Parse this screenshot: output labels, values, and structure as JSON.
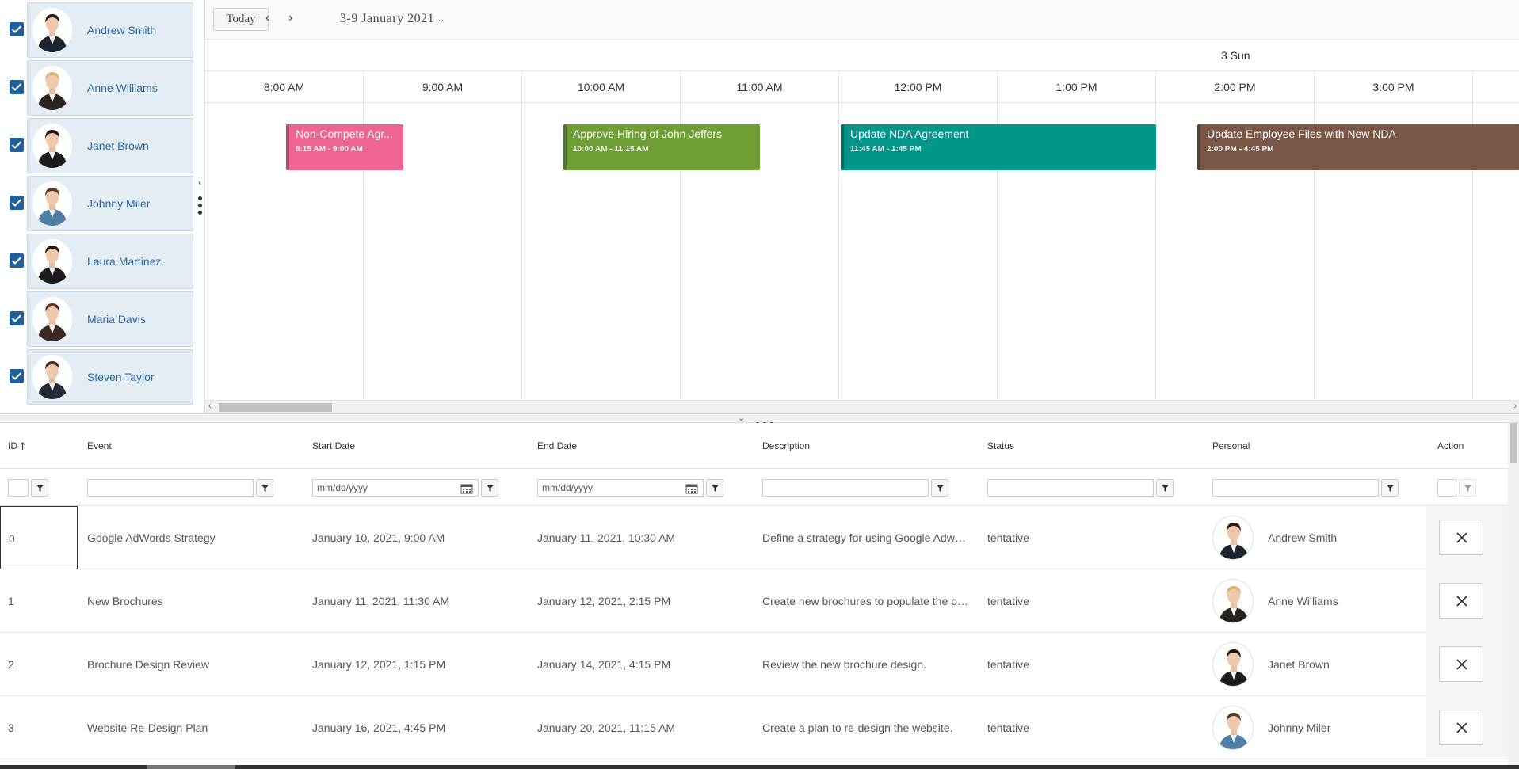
{
  "people": [
    {
      "name": "Andrew Smith",
      "checked": true,
      "suit": "#1c2430",
      "hair": "#2b1d14"
    },
    {
      "name": "Anne Williams",
      "checked": true,
      "suit": "#2a2420",
      "hair": "#d9b77a"
    },
    {
      "name": "Janet Brown",
      "checked": true,
      "suit": "#1d1d1d",
      "hair": "#201611"
    },
    {
      "name": "Johnny Miler",
      "checked": true,
      "suit": "#4c7ea6",
      "hair": "#5a3e2b"
    },
    {
      "name": "Laura Martinez",
      "checked": true,
      "suit": "#1b1b1b",
      "hair": "#241a14"
    },
    {
      "name": "Maria Davis",
      "checked": true,
      "suit": "#3a2a24",
      "hair": "#5a2f22"
    },
    {
      "name": "Steven Taylor",
      "checked": true,
      "suit": "#222a36",
      "hair": "#4a3020"
    }
  ],
  "toolbar": {
    "today_label": "Today",
    "prev_icon": "chevron-left-icon",
    "next_icon": "chevron-right-icon",
    "date_range": "3-9 January 2021",
    "dropdown_icon": "chevron-down-icon"
  },
  "scheduler": {
    "day_label": "3 Sun",
    "time_slots": [
      "8:00 AM",
      "9:00 AM",
      "10:00 AM",
      "11:00 AM",
      "12:00 PM",
      "1:00 PM",
      "2:00 PM",
      "3:00 PM"
    ],
    "events": [
      {
        "title": "Non-Compete Agr...",
        "time": "8:15 AM - 9:00 AM",
        "color": "#ee6592"
      },
      {
        "title": "Approve Hiring of John Jeffers",
        "time": "10:00 AM - 11:15 AM",
        "color": "#6f9e35"
      },
      {
        "title": "Update NDA Agreement",
        "time": "11:45 AM - 1:45 PM",
        "color": "#00968a"
      },
      {
        "title": "Update Employee Files with New NDA",
        "time": "2:00 PM - 4:45 PM",
        "color": "#7a5647"
      }
    ]
  },
  "grid": {
    "columns": [
      "ID",
      "Event",
      "Start Date",
      "End Date",
      "Description",
      "Status",
      "Personal",
      "Action"
    ],
    "sort_icon": "arrow-up-icon",
    "date_placeholder": "mm/dd/yyyy",
    "rows": [
      {
        "id": "0",
        "event": "Google AdWords Strategy",
        "start": "January 10, 2021, 9:00 AM",
        "end": "January 11, 2021, 10:30 AM",
        "description": "Define a strategy for using Google Adwords",
        "status": "tentative",
        "personal": "Andrew Smith",
        "selected": true
      },
      {
        "id": "1",
        "event": "New Brochures",
        "start": "January 11, 2021, 11:30 AM",
        "end": "January 12, 2021, 2:15 PM",
        "description": "Create new brochures to populate the product",
        "status": "tentative",
        "personal": "Anne Williams",
        "selected": false
      },
      {
        "id": "2",
        "event": "Brochure Design Review",
        "start": "January 12, 2021, 1:15 PM",
        "end": "January 14, 2021, 4:15 PM",
        "description": "Review the new brochure design.",
        "status": "tentative",
        "personal": "Janet Brown",
        "selected": false
      },
      {
        "id": "3",
        "event": "Website Re-Design Plan",
        "start": "January 16, 2021, 4:45 PM",
        "end": "January 20, 2021, 11:15 AM",
        "description": "Create a plan to re-design the website.",
        "status": "tentative",
        "personal": "Johnny Miler",
        "selected": false
      }
    ]
  }
}
